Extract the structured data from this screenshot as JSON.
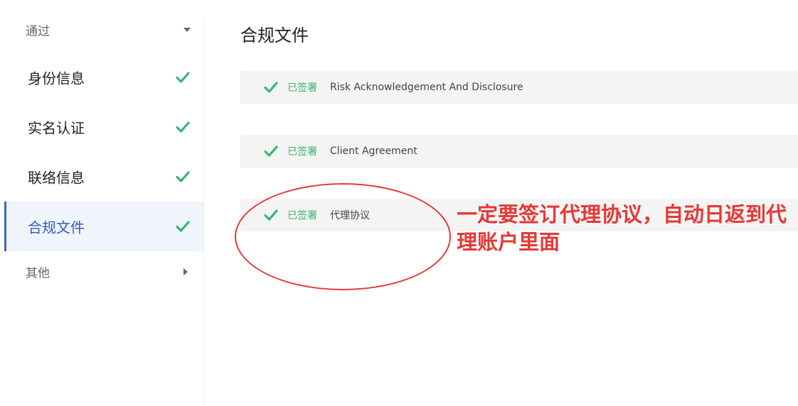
{
  "sidebar": {
    "pass_header": {
      "label": "通过",
      "icon": "chevron-down-icon"
    },
    "items": [
      {
        "label": "身份信息",
        "icon": "check-icon",
        "active": false
      },
      {
        "label": "实名认证",
        "icon": "check-icon",
        "active": false
      },
      {
        "label": "联络信息",
        "icon": "check-icon",
        "active": false
      },
      {
        "label": "合规文件",
        "icon": "check-icon",
        "active": true
      }
    ],
    "other_header": {
      "label": "其他",
      "icon": "chevron-right-icon"
    }
  },
  "main": {
    "title": "合规文件",
    "documents": [
      {
        "status": "已签署",
        "name": "Risk Acknowledgement And Disclosure"
      },
      {
        "status": "已签署",
        "name": "Client Agreement"
      },
      {
        "status": "已签署",
        "name": "代理协议"
      }
    ]
  },
  "annotation": {
    "text": "一定要签订代理协议，自动日返到代理账户里面"
  },
  "colors": {
    "check": "#3cb371",
    "accent": "#3b64c8",
    "annotation": "#e53935"
  }
}
